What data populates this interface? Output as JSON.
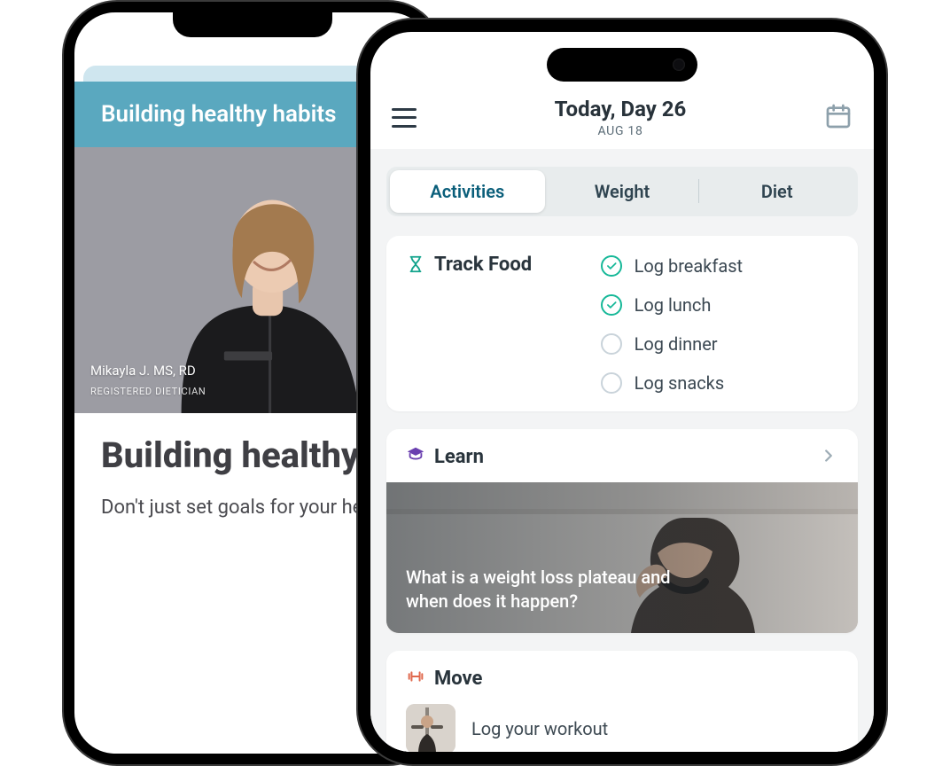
{
  "back": {
    "banner_title": "Building healthy habits",
    "coach_name": "Mikayla J. MS, RD",
    "coach_title": "REGISTERED DIETICIAN",
    "article_title": "Building healthy habits",
    "article_body": "Don't just set goals for your health, establish habits that will get you there. Pick an outcome, like losing weight, decreasing blood pressure or managing blood sugar, and"
  },
  "front": {
    "header": {
      "title": "Today, Day 26",
      "subtitle": "AUG 18"
    },
    "tabs": {
      "activities": "Activities",
      "weight": "Weight",
      "diet": "Diet"
    },
    "track": {
      "title": "Track Food",
      "items": [
        {
          "label": "Log breakfast",
          "done": true
        },
        {
          "label": "Log lunch",
          "done": true
        },
        {
          "label": "Log dinner",
          "done": false
        },
        {
          "label": "Log snacks",
          "done": false
        }
      ]
    },
    "learn": {
      "title": "Learn",
      "hero_text": "What is a weight loss plateau and when does it happen?"
    },
    "move": {
      "title": "Move",
      "cta": "Log your workout"
    }
  }
}
